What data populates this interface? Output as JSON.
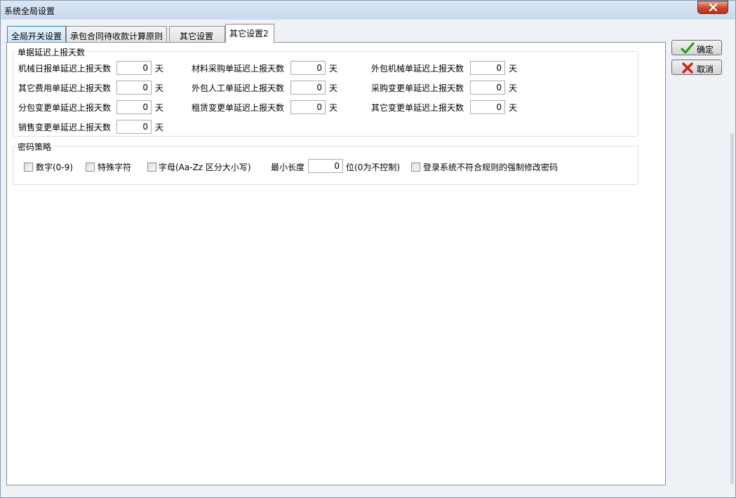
{
  "window": {
    "title": "系统全局设置",
    "close_icon": "close-icon"
  },
  "tabs": [
    {
      "label": "全局开关设置",
      "state": "highlight"
    },
    {
      "label": "承包合同待收款计算原则",
      "state": "normal"
    },
    {
      "label": "其它设置",
      "state": "normal"
    },
    {
      "label": "其它设置2",
      "state": "active"
    }
  ],
  "delay_group": {
    "title": "单据延迟上报天数",
    "unit": "天",
    "fields": [
      {
        "label": "机械日报单延迟上报天数",
        "value": "0"
      },
      {
        "label": "材料采购单延迟上报天数",
        "value": "0"
      },
      {
        "label": "外包机械单延迟上报天数",
        "value": "0"
      },
      {
        "label": "其它费用单延迟上报天数",
        "value": "0"
      },
      {
        "label": "外包人工单延迟上报天数",
        "value": "0"
      },
      {
        "label": "采购变更单延迟上报天数",
        "value": "0"
      },
      {
        "label": "分包变更单延迟上报天数",
        "value": "0"
      },
      {
        "label": "租赁变更单延迟上报天数",
        "value": "0"
      },
      {
        "label": "其它变更单延迟上报天数",
        "value": "0"
      },
      {
        "label": "销售变更单延迟上报天数",
        "value": "0"
      }
    ]
  },
  "password_group": {
    "title": "密码策略",
    "digits_label": "数字(0-9)",
    "digits_checked": false,
    "special_label": "特殊字符",
    "special_checked": false,
    "letters_label": "字母(Aa-Zz  区分大小写)",
    "letters_checked": false,
    "min_length_label": "最小长度",
    "min_length_value": "0",
    "min_length_suffix": "位(0为不控制)",
    "force_change_label": "登录系统不符合规则的强制修改密码",
    "force_change_checked": false
  },
  "buttons": {
    "ok_label": "确定",
    "ok_icon": "checkmark-icon",
    "ok_icon_color": "#2e9a1f",
    "cancel_label": "取消",
    "cancel_icon": "cross-icon",
    "cancel_icon_color": "#c9231a"
  }
}
